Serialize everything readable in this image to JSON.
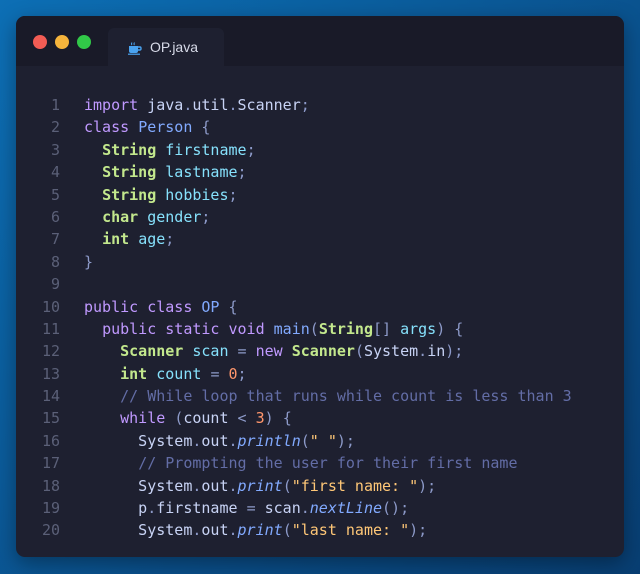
{
  "tab": {
    "label": "OP.java",
    "icon": "java-cup-icon"
  },
  "window_controls": [
    "close",
    "minimize",
    "maximize"
  ],
  "lines": [
    {
      "n": "1",
      "tokens": [
        [
          "kw",
          "import"
        ],
        [
          "plain",
          " java"
        ],
        [
          "punc",
          "."
        ],
        [
          "plain",
          "util"
        ],
        [
          "punc",
          "."
        ],
        [
          "plain",
          "Scanner"
        ],
        [
          "punc",
          ";"
        ]
      ]
    },
    {
      "n": "2",
      "tokens": [
        [
          "kw",
          "class"
        ],
        [
          "plain",
          " "
        ],
        [
          "cls",
          "Person"
        ],
        [
          "plain",
          " "
        ],
        [
          "punc",
          "{"
        ]
      ]
    },
    {
      "n": "3",
      "tokens": [
        [
          "plain",
          "  "
        ],
        [
          "ty",
          "String"
        ],
        [
          "plain",
          " "
        ],
        [
          "var",
          "firstname"
        ],
        [
          "punc",
          ";"
        ]
      ]
    },
    {
      "n": "4",
      "tokens": [
        [
          "plain",
          "  "
        ],
        [
          "ty",
          "String"
        ],
        [
          "plain",
          " "
        ],
        [
          "var",
          "lastname"
        ],
        [
          "punc",
          ";"
        ]
      ]
    },
    {
      "n": "5",
      "tokens": [
        [
          "plain",
          "  "
        ],
        [
          "ty",
          "String"
        ],
        [
          "plain",
          " "
        ],
        [
          "var",
          "hobbies"
        ],
        [
          "punc",
          ";"
        ]
      ]
    },
    {
      "n": "6",
      "tokens": [
        [
          "plain",
          "  "
        ],
        [
          "ty",
          "char"
        ],
        [
          "plain",
          " "
        ],
        [
          "var",
          "gender"
        ],
        [
          "punc",
          ";"
        ]
      ]
    },
    {
      "n": "7",
      "tokens": [
        [
          "plain",
          "  "
        ],
        [
          "ty",
          "int"
        ],
        [
          "plain",
          " "
        ],
        [
          "var",
          "age"
        ],
        [
          "punc",
          ";"
        ]
      ]
    },
    {
      "n": "8",
      "tokens": [
        [
          "punc",
          "}"
        ]
      ]
    },
    {
      "n": "9",
      "tokens": []
    },
    {
      "n": "10",
      "tokens": [
        [
          "kw",
          "public"
        ],
        [
          "plain",
          " "
        ],
        [
          "kw",
          "class"
        ],
        [
          "plain",
          " "
        ],
        [
          "cls",
          "OP"
        ],
        [
          "plain",
          " "
        ],
        [
          "punc",
          "{"
        ]
      ]
    },
    {
      "n": "11",
      "tokens": [
        [
          "plain",
          "  "
        ],
        [
          "kw",
          "public"
        ],
        [
          "plain",
          " "
        ],
        [
          "kw",
          "static"
        ],
        [
          "plain",
          " "
        ],
        [
          "kw",
          "void"
        ],
        [
          "plain",
          " "
        ],
        [
          "fn",
          "main"
        ],
        [
          "punc",
          "("
        ],
        [
          "ty",
          "String"
        ],
        [
          "punc",
          "[]"
        ],
        [
          "plain",
          " "
        ],
        [
          "var",
          "args"
        ],
        [
          "punc",
          ")"
        ],
        [
          "plain",
          " "
        ],
        [
          "punc",
          "{"
        ]
      ]
    },
    {
      "n": "12",
      "tokens": [
        [
          "plain",
          "    "
        ],
        [
          "ty",
          "Scanner"
        ],
        [
          "plain",
          " "
        ],
        [
          "var",
          "scan"
        ],
        [
          "plain",
          " "
        ],
        [
          "punc",
          "="
        ],
        [
          "plain",
          " "
        ],
        [
          "kw",
          "new"
        ],
        [
          "plain",
          " "
        ],
        [
          "ty",
          "Scanner"
        ],
        [
          "punc",
          "("
        ],
        [
          "plain",
          "System"
        ],
        [
          "punc",
          "."
        ],
        [
          "plain",
          "in"
        ],
        [
          "punc",
          ");"
        ]
      ]
    },
    {
      "n": "13",
      "tokens": [
        [
          "plain",
          "    "
        ],
        [
          "ty",
          "int"
        ],
        [
          "plain",
          " "
        ],
        [
          "var",
          "count"
        ],
        [
          "plain",
          " "
        ],
        [
          "punc",
          "="
        ],
        [
          "plain",
          " "
        ],
        [
          "num",
          "0"
        ],
        [
          "punc",
          ";"
        ]
      ]
    },
    {
      "n": "14",
      "tokens": [
        [
          "plain",
          "    "
        ],
        [
          "com",
          "// While loop that runs while count is less than 3"
        ]
      ]
    },
    {
      "n": "15",
      "tokens": [
        [
          "plain",
          "    "
        ],
        [
          "kw",
          "while"
        ],
        [
          "plain",
          " "
        ],
        [
          "punc",
          "("
        ],
        [
          "plain",
          "count "
        ],
        [
          "punc",
          "<"
        ],
        [
          "plain",
          " "
        ],
        [
          "num",
          "3"
        ],
        [
          "punc",
          ")"
        ],
        [
          "plain",
          " "
        ],
        [
          "punc",
          "{"
        ]
      ]
    },
    {
      "n": "16",
      "tokens": [
        [
          "plain",
          "      System"
        ],
        [
          "punc",
          "."
        ],
        [
          "plain",
          "out"
        ],
        [
          "punc",
          "."
        ],
        [
          "meth",
          "println"
        ],
        [
          "punc",
          "("
        ],
        [
          "str",
          "\" \""
        ],
        [
          "punc",
          ");"
        ]
      ]
    },
    {
      "n": "17",
      "tokens": [
        [
          "plain",
          "      "
        ],
        [
          "com",
          "// Prompting the user for their first name"
        ]
      ]
    },
    {
      "n": "18",
      "tokens": [
        [
          "plain",
          "      System"
        ],
        [
          "punc",
          "."
        ],
        [
          "plain",
          "out"
        ],
        [
          "punc",
          "."
        ],
        [
          "meth",
          "print"
        ],
        [
          "punc",
          "("
        ],
        [
          "str",
          "\"first name: \""
        ],
        [
          "punc",
          ");"
        ]
      ]
    },
    {
      "n": "19",
      "tokens": [
        [
          "plain",
          "      p"
        ],
        [
          "punc",
          "."
        ],
        [
          "plain",
          "firstname "
        ],
        [
          "punc",
          "="
        ],
        [
          "plain",
          " scan"
        ],
        [
          "punc",
          "."
        ],
        [
          "meth",
          "nextLine"
        ],
        [
          "punc",
          "();"
        ]
      ]
    },
    {
      "n": "20",
      "tokens": [
        [
          "plain",
          "      System"
        ],
        [
          "punc",
          "."
        ],
        [
          "plain",
          "out"
        ],
        [
          "punc",
          "."
        ],
        [
          "meth",
          "print"
        ],
        [
          "punc",
          "("
        ],
        [
          "str",
          "\"last name: \""
        ],
        [
          "punc",
          ");"
        ]
      ]
    }
  ]
}
